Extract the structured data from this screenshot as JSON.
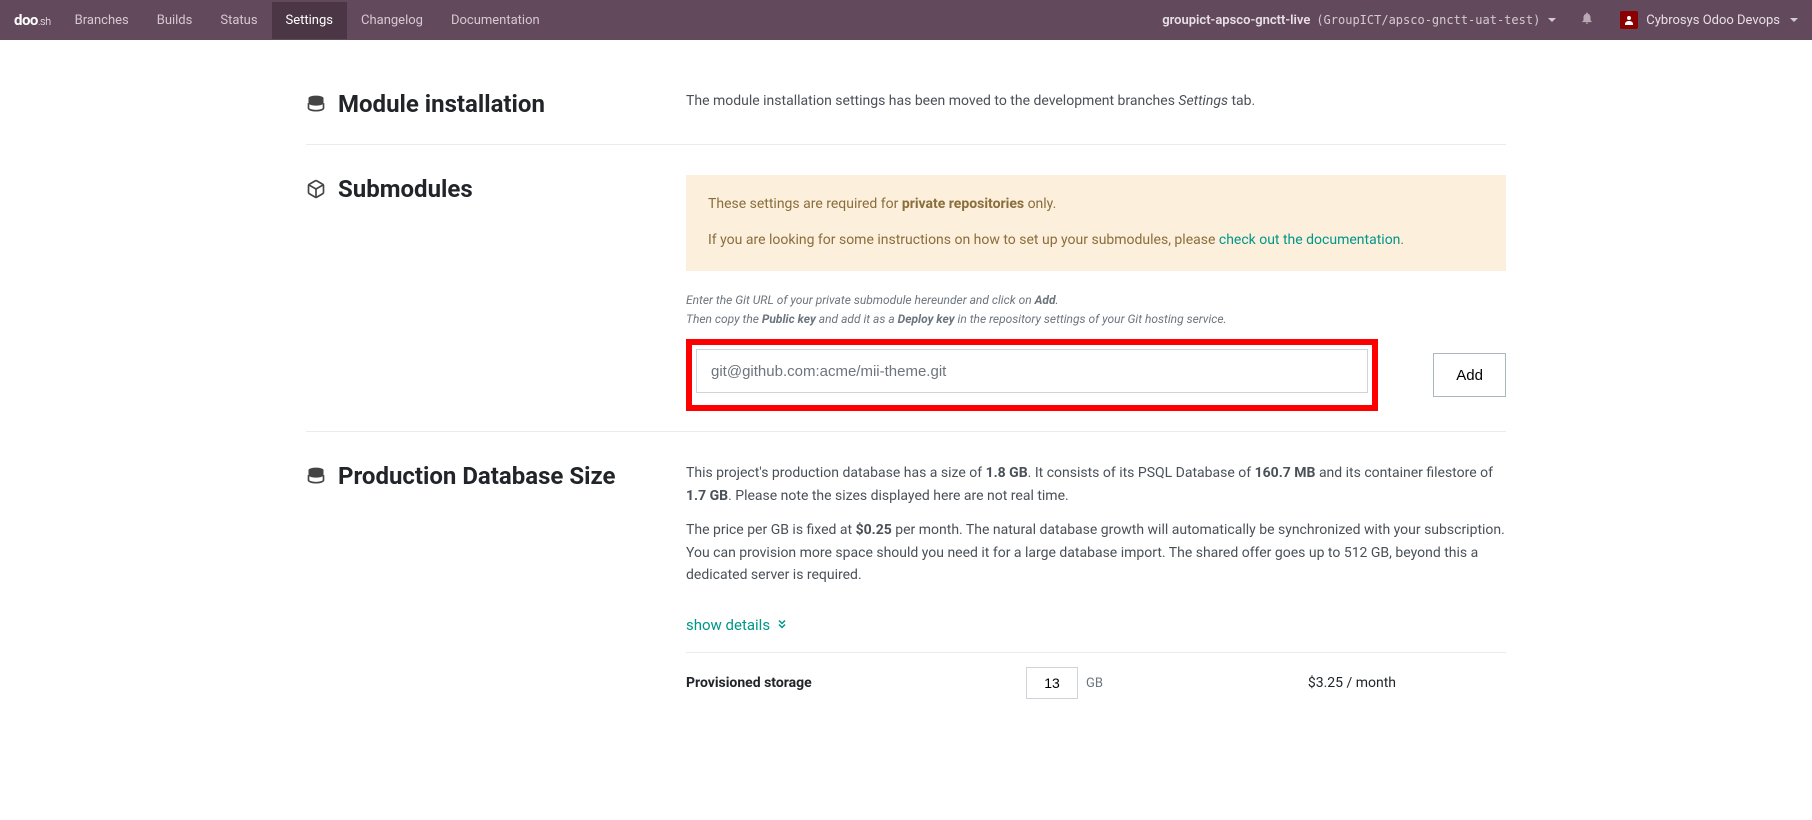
{
  "nav": {
    "brand_main": "doo",
    "brand_suffix": ".sh",
    "items": [
      "Branches",
      "Builds",
      "Status",
      "Settings",
      "Changelog",
      "Documentation"
    ],
    "active_index": 3,
    "project_bold": "groupict-apsco-gnctt-live",
    "project_mono": "(GroupICT/apsco-gnctt-uat-test)",
    "user_name": "Cybrosys Odoo Devops"
  },
  "module_install": {
    "title": "Module installation",
    "desc_pre": "The module installation settings has been moved to the development branches ",
    "desc_em": "Settings",
    "desc_post": " tab."
  },
  "submodules": {
    "title": "Submodules",
    "warn1_pre": "These settings are required for ",
    "warn1_bold": "private repositories",
    "warn1_post": " only.",
    "warn2_pre": "If you are looking for some instructions on how to set up your submodules, please ",
    "warn2_link": "check out the documentation",
    "warn2_post": ".",
    "help1_pre": "Enter the Git URL of your private submodule hereunder and click on ",
    "help1_bold": "Add",
    "help1_post": ".",
    "help2_pre": "Then copy the ",
    "help2_b1": "Public key",
    "help2_mid": " and add it as a ",
    "help2_b2": "Deploy key",
    "help2_post": " in the repository settings of your Git hosting service.",
    "input_placeholder": "git@github.com:acme/mii-theme.git",
    "add_btn": "Add"
  },
  "dbsize": {
    "title": "Production Database Size",
    "p1_a": "This project's production database has a size of ",
    "p1_b1": "1.8 GB",
    "p1_b": ". It consists of its PSQL Database of ",
    "p1_b2": "160.7 MB",
    "p1_c": " and its container filestore of ",
    "p1_b3": "1.7 GB",
    "p1_d": ". Please note the sizes displayed here are not real time.",
    "p2_a": "The price per GB is fixed at ",
    "p2_b1": "$0.25",
    "p2_b": " per month. The natural database growth will automatically be synchronized with your subscription. You can provision more space should you need it for a large database import. The shared offer goes up to 512 GB, beyond this a dedicated server is required.",
    "show_details": "show details",
    "storage_label": "Provisioned storage",
    "storage_value": "13",
    "gb_label": "GB",
    "storage_price": "$3.25 / month"
  }
}
